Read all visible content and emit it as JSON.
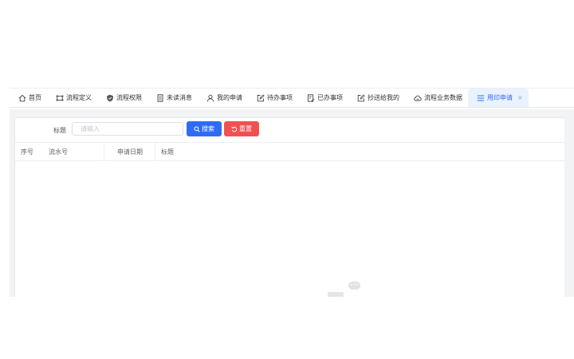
{
  "tabs": [
    {
      "label": "首页",
      "icon": "home-icon"
    },
    {
      "label": "流程定义",
      "icon": "flow-icon"
    },
    {
      "label": "流程权限",
      "icon": "shield-icon"
    },
    {
      "label": "未读消息",
      "icon": "document-icon"
    },
    {
      "label": "我的申请",
      "icon": "user-icon"
    },
    {
      "label": "待办事项",
      "icon": "edit-icon"
    },
    {
      "label": "已办事项",
      "icon": "done-list-icon"
    },
    {
      "label": "抄送给我的",
      "icon": "edit-icon"
    },
    {
      "label": "流程业务数据",
      "icon": "cloud-icon"
    },
    {
      "label": "用印申请",
      "icon": "menu-icon",
      "active": true
    }
  ],
  "tab_close_glyph": "×",
  "search": {
    "label": "标题",
    "placeholder": "请输入",
    "search_button": "搜索",
    "reset_button": "重置"
  },
  "table": {
    "columns": [
      "序号",
      "流水号",
      "申请日期",
      "标题"
    ]
  },
  "float_widget": {
    "glyph": "•••"
  },
  "colors": {
    "primary": "#2f6cf6",
    "danger": "#f25050",
    "active_tab_bg": "#eaf2ff"
  }
}
